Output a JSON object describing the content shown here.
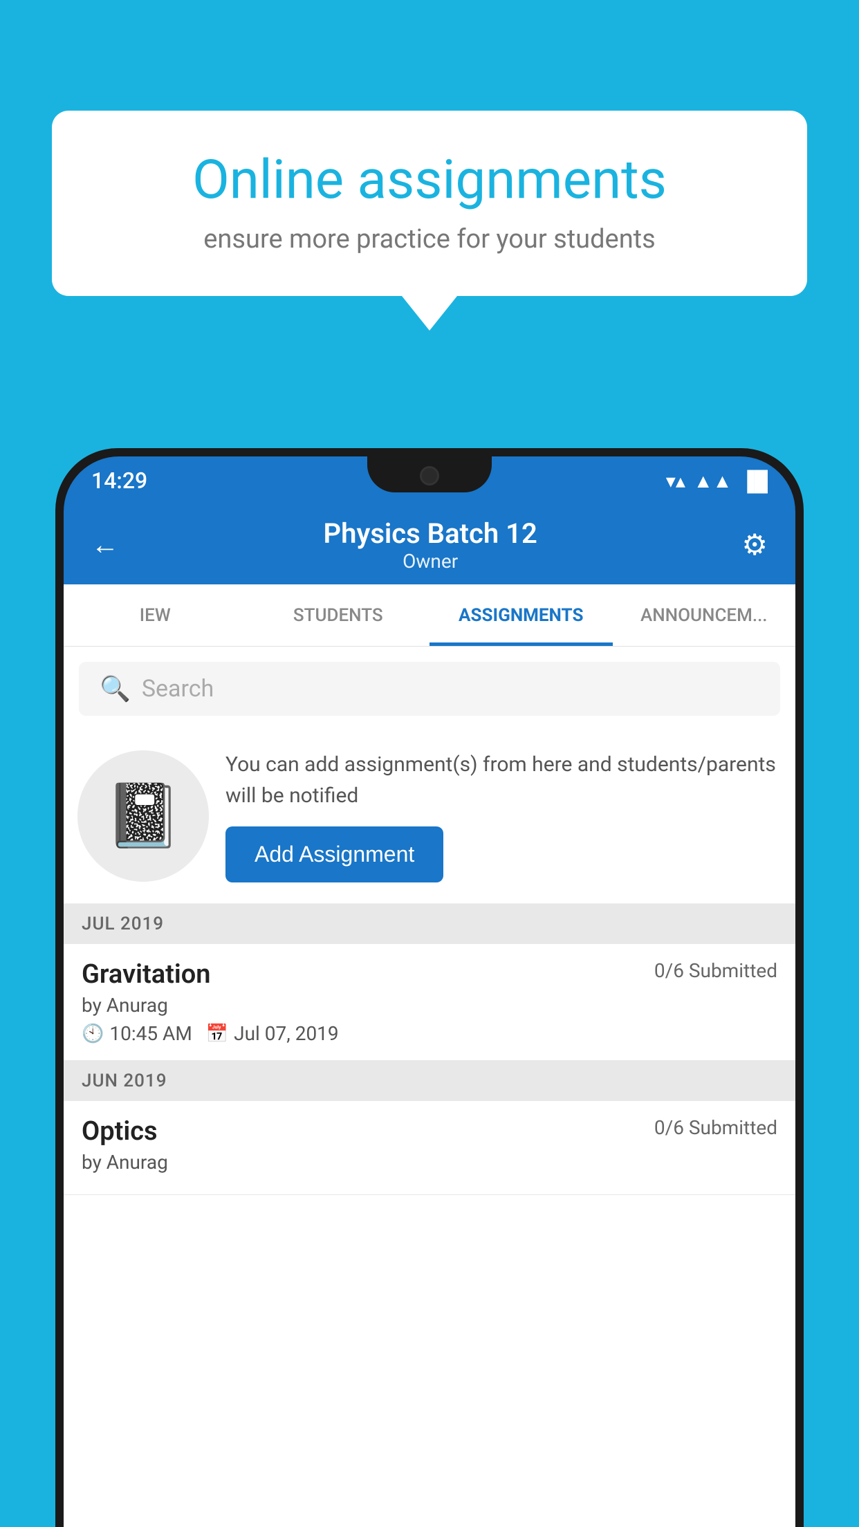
{
  "background": {
    "color": "#1ab3e0"
  },
  "speech_bubble": {
    "title": "Online assignments",
    "subtitle": "ensure more practice for your students"
  },
  "status_bar": {
    "time": "14:29",
    "wifi": "▼",
    "signal": "▲",
    "battery": "▓"
  },
  "app_bar": {
    "title": "Physics Batch 12",
    "subtitle": "Owner",
    "back_label": "←",
    "settings_label": "⚙"
  },
  "tabs": [
    {
      "label": "IEW",
      "active": false
    },
    {
      "label": "STUDENTS",
      "active": false
    },
    {
      "label": "ASSIGNMENTS",
      "active": true
    },
    {
      "label": "ANNOUNCEM...",
      "active": false
    }
  ],
  "search": {
    "placeholder": "Search"
  },
  "add_assignment": {
    "description": "You can add assignment(s) from here and students/parents will be notified",
    "button_label": "Add Assignment",
    "icon": "📓"
  },
  "sections": [
    {
      "header": "JUL 2019",
      "assignments": [
        {
          "name": "Gravitation",
          "submitted": "0/6 Submitted",
          "by": "by Anurag",
          "time": "10:45 AM",
          "date": "Jul 07, 2019"
        }
      ]
    },
    {
      "header": "JUN 2019",
      "assignments": [
        {
          "name": "Optics",
          "submitted": "0/6 Submitted",
          "by": "by Anurag",
          "time": "",
          "date": ""
        }
      ]
    }
  ]
}
